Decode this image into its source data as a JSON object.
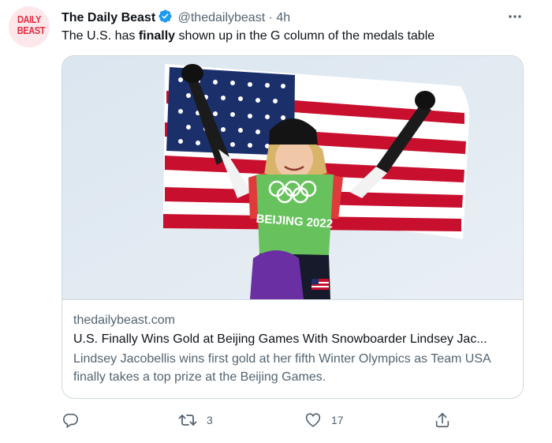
{
  "author": {
    "display_name": "The Daily Beast",
    "handle": "@thedailybeast",
    "separator": "·",
    "time": "4h",
    "avatar_text_line1": "DAILY",
    "avatar_text_line2": "BEAST"
  },
  "tweet": {
    "text_before": "The U.S. has ",
    "text_bold": "finally",
    "text_after": " shown up in the G column of the medals table"
  },
  "card": {
    "domain": "thedailybeast.com",
    "title": "U.S. Finally Wins Gold at Beijing Games With Snowboarder Lindsey Jac...",
    "description": "Lindsey Jacobellis wins first gold at her fifth Winter Olympics as Team USA finally takes a top prize at the Beijing Games.",
    "image_text": "BEIJING 2022"
  },
  "actions": {
    "reply_count": "",
    "retweet_count": "3",
    "like_count": "17",
    "share_count": ""
  },
  "colors": {
    "accent": "#1d9bf0",
    "secondary_text": "#536471",
    "border": "#cfd9de"
  },
  "icons": [
    "more-icon",
    "verified-icon",
    "reply-icon",
    "retweet-icon",
    "like-icon",
    "share-icon"
  ]
}
